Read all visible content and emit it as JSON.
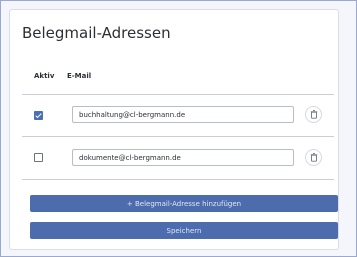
{
  "section": {
    "title": "Belegmail-Adressen"
  },
  "table": {
    "headers": {
      "active": "Aktiv",
      "email": "E-Mail"
    },
    "rows": [
      {
        "active": true,
        "email": "buchhaltung@cl-bergmann.de"
      },
      {
        "active": false,
        "email": "dokumente@cl-bergmann.de"
      }
    ]
  },
  "actions": {
    "add_label": "+ Belegmail-Adresse hinzufügen",
    "save_label": "Speichern"
  },
  "colors": {
    "primary": "#4d6cae",
    "checkbox_checked": "#4a6fb5"
  },
  "icons": {
    "delete": "trash-icon",
    "checked": "checkmark-icon"
  }
}
